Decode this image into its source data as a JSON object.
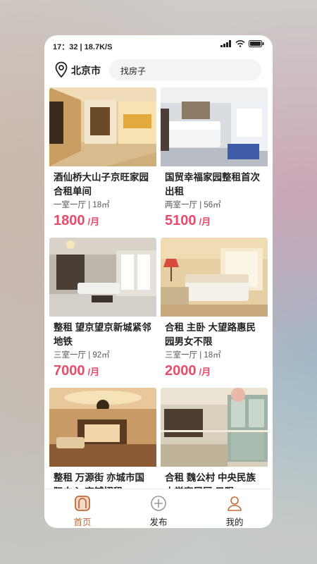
{
  "status_bar": {
    "time": "17：32 | 18.7K/S"
  },
  "header": {
    "city": "北京市",
    "search_text": "找房子"
  },
  "listings": [
    {
      "title": "酒仙桥大山子京旺家园合租单间",
      "meta": "一室一厅 | 18㎡",
      "price": "1800",
      "unit": "/月"
    },
    {
      "title": "国贸幸福家园整租首次出租",
      "meta": "两室一厅 | 56㎡",
      "price": "5100",
      "unit": "/月"
    },
    {
      "title": "整租 望京望京新城紧邻地铁",
      "meta": "三室一厅 | 92㎡",
      "price": "7000",
      "unit": "/月"
    },
    {
      "title": "合租 主卧 大望路惠民园男女不限",
      "meta": "三室一厅 | 18㎡",
      "price": "2000",
      "unit": "/月"
    },
    {
      "title": "整租 万源街 亦城市国际中心 商铺招租",
      "meta": "",
      "price": "",
      "unit": ""
    },
    {
      "title": "合租 魏公村 中央民族大学家属区 只限",
      "meta": "",
      "price": "",
      "unit": ""
    }
  ],
  "tab_bar": {
    "tabs": [
      {
        "label": "首页",
        "icon": "home-icon",
        "active": true
      },
      {
        "label": "发布",
        "icon": "plus-circle-icon",
        "active": false
      },
      {
        "label": "我的",
        "icon": "user-icon",
        "active": false
      }
    ],
    "active_color": "#c06b3a"
  },
  "colors": {
    "price": "#e94b6a",
    "accent": "#c06b3a"
  }
}
